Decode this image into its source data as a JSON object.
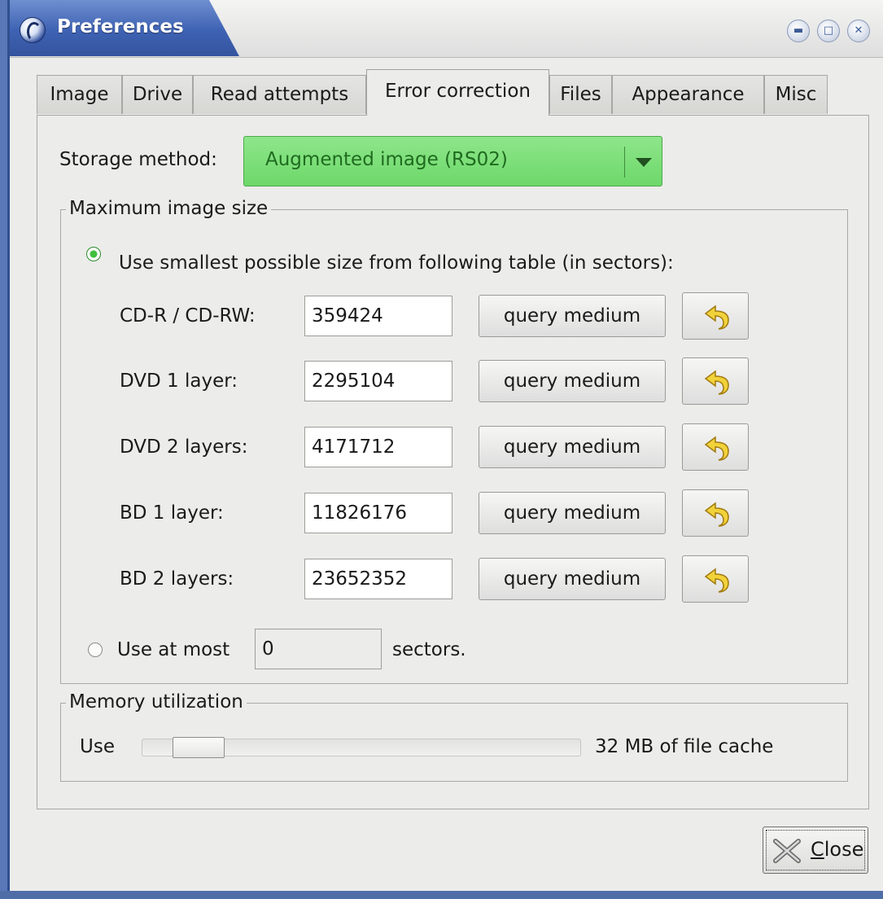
{
  "window": {
    "title": "Preferences",
    "controls": [
      "minimize",
      "maximize",
      "close"
    ]
  },
  "tabs": [
    {
      "label": "Image",
      "active": false
    },
    {
      "label": "Drive",
      "active": false
    },
    {
      "label": "Read attempts",
      "active": false
    },
    {
      "label": "Error correction",
      "active": true
    },
    {
      "label": "Files",
      "active": false
    },
    {
      "label": "Appearance",
      "active": false
    },
    {
      "label": "Misc",
      "active": false
    }
  ],
  "storage": {
    "label": "Storage method:",
    "value": "Augmented image (RS02)",
    "color": "#7ddf79"
  },
  "max_image_size": {
    "title": "Maximum image size",
    "option_table": {
      "label": "Use smallest possible size from following table (in sectors):",
      "selected": true
    },
    "rows": [
      {
        "label": "CD-R / CD-RW:",
        "value": "359424",
        "button": "query medium"
      },
      {
        "label": "DVD 1 layer:",
        "value": "2295104",
        "button": "query medium"
      },
      {
        "label": "DVD 2 layers:",
        "value": "4171712",
        "button": "query medium"
      },
      {
        "label": "BD 1 layer:",
        "value": "11826176",
        "button": "query medium"
      },
      {
        "label": "BD 2 layers:",
        "value": "23652352",
        "button": "query medium"
      }
    ],
    "option_atmost": {
      "label": "Use at most",
      "value": "0",
      "suffix": "sectors.",
      "selected": false
    }
  },
  "memory": {
    "title": "Memory utilization",
    "prefix": "Use",
    "suffix": "32 MB of file cache",
    "slider_fraction": 0.08
  },
  "footer": {
    "close_mnemonic": "C",
    "close_rest": "lose"
  }
}
